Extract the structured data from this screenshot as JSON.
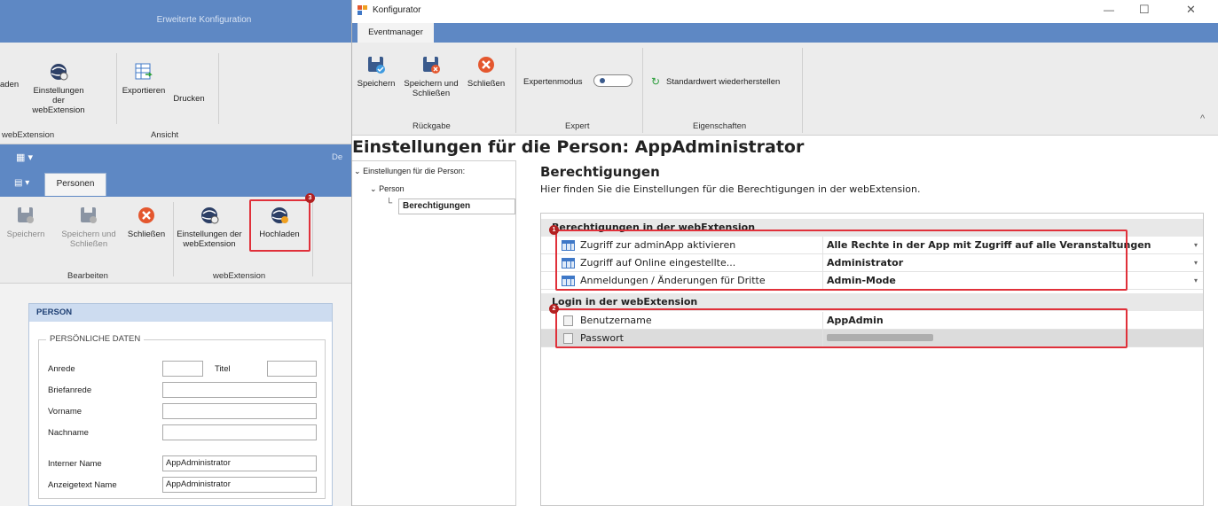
{
  "back_window": {
    "title": "Erweiterte Konfiguration",
    "ribbon_top": {
      "partial_label": "aden",
      "settings_label": "Einstellungen der webExtension",
      "export_label": "Exportieren",
      "print_label": "Drucken",
      "group1": "webExtension",
      "group2": "Ansicht"
    },
    "small_title_partial": "De",
    "tab_label": "Personen",
    "ribbon_bottom": {
      "save_label": "Speichern",
      "save_close_label": "Speichern und Schließen",
      "close_label": "Schließen",
      "settings_label": "Einstellungen der webExtension",
      "upload_label": "Hochladen",
      "group_edit": "Bearbeiten",
      "group_webext": "webExtension",
      "badge3": "3"
    },
    "panel": {
      "header": "PERSON",
      "section": "PERSÖNLICHE DATEN",
      "fields": {
        "anrede": "Anrede",
        "titel": "Titel",
        "briefanrede": "Briefanrede",
        "vorname": "Vorname",
        "nachname": "Nachname",
        "interner_name": "Interner Name",
        "interner_name_value": "AppAdministrator",
        "anzeigetext_name": "Anzeigetext Name",
        "anzeigetext_name_value": "AppAdministrator"
      }
    }
  },
  "front_window": {
    "title": "Konfigurator",
    "window_controls": {
      "minimize": "—",
      "maximize": "☐",
      "close": "✕"
    },
    "tab": "Eventmanager",
    "ribbon": {
      "save_label": "Speichern",
      "save_close_label": "Speichern und Schließen",
      "close_label": "Schließen",
      "group_return": "Rückgabe",
      "expert_mode_label": "Expertenmodus",
      "expert_mode_on": false,
      "group_expert": "Expert",
      "restore_label": "Standardwert wiederherstellen",
      "group_properties": "Eigenschaften",
      "collapse_glyph": "^"
    },
    "page_title": "Einstellungen für die Person: AppAdministrator",
    "tree": {
      "root": "Einstellungen für die Person:",
      "child": "Person",
      "leaf": "Berechtigungen"
    },
    "main": {
      "heading": "Berechtigungen",
      "description": "Hier finden Sie die Einstellungen für die Berechtigungen in der webExtension."
    },
    "grid": {
      "category1": "Berechtigungen in der webExtension",
      "rows1": [
        {
          "name": "Zugriff zur adminApp aktivieren",
          "value": "Alle Rechte in der App mit Zugriff auf alle Veranstaltungen"
        },
        {
          "name": "Zugriff auf Online eingestellte...",
          "value": "Administrator"
        },
        {
          "name": "Anmeldungen / Änderungen für Dritte",
          "value": "Admin-Mode"
        }
      ],
      "category2": "Login in der webExtension",
      "rows2": [
        {
          "name": "Benutzername",
          "value": "AppAdmin"
        },
        {
          "name": "Passwort",
          "value": ""
        }
      ],
      "badge1": "1",
      "badge2": "2"
    }
  },
  "colors": {
    "ribbon_blue": "#5e88c4",
    "highlight_red": "#e0303a",
    "badge_red": "#b22020",
    "close_orange": "#e4572e"
  }
}
